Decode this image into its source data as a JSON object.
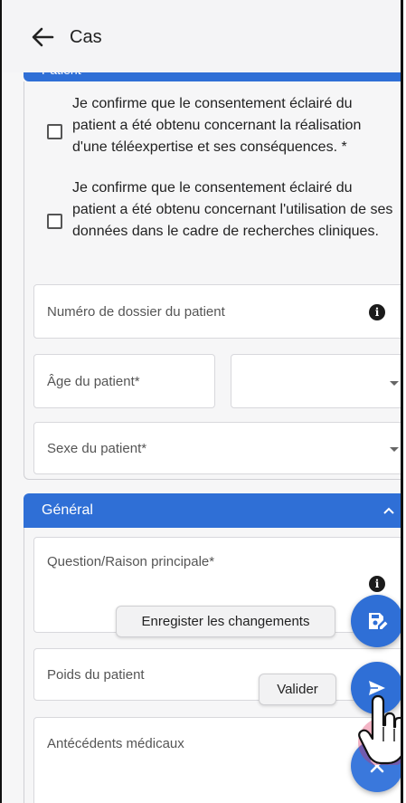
{
  "app": {
    "title": "Cas"
  },
  "patient_section": {
    "header": "Patient",
    "consent_1": "Je confirme que le consentement éclairé du patient a été obtenu concernant la réalisation d'une téléexpertise et ses conséquences. *",
    "consent_2": "Je confirme que le consentement éclairé du patient a été obtenu concernant l'utilisation de ses données dans le cadre de recherches cliniques.",
    "dossier_label": "Numéro de dossier du patient",
    "age_label": "Âge du patient*",
    "age_unit_value": "",
    "sexe_label": "Sexe du patient*"
  },
  "general_section": {
    "header": "Général",
    "question_label": "Question/Raison principale*",
    "poids_label": "Poids du patient",
    "antecedents_label": "Antécédents médicaux"
  },
  "actions": {
    "save_tooltip": "Enregister les changements",
    "submit_tooltip": "Valider"
  },
  "colors": {
    "accent": "#2f6fd6",
    "background": "#f6f6f7"
  }
}
